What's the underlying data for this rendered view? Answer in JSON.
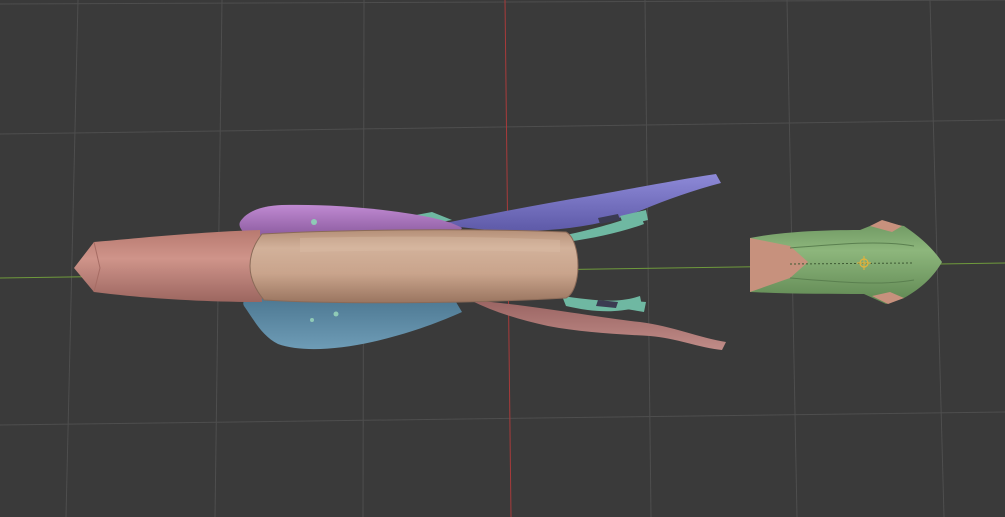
{
  "app": {
    "view": "3d-viewport",
    "mode": "sculpt-preview",
    "shading": "solid-random-color"
  },
  "viewport": {
    "background_color": "#3a3a3a",
    "grid_color": "#505050",
    "x_axis_color": "#6f9a3c",
    "y_axis_color": "#a83a3a"
  },
  "objects": [
    {
      "name": "main-body",
      "color": "#c9a48c"
    },
    {
      "name": "nose-cone",
      "color": "#c98a80"
    },
    {
      "name": "upper-left-wing",
      "color": "#b076c4"
    },
    {
      "name": "upper-right-fin",
      "color": "#7c78c8"
    },
    {
      "name": "lower-left-wing",
      "color": "#5e8aa4"
    },
    {
      "name": "lower-right-fin",
      "color": "#b07a78"
    },
    {
      "name": "teal-struts",
      "color": "#6fb8a2"
    },
    {
      "name": "detached-green-part",
      "color": "#7ea86e"
    },
    {
      "name": "green-part-rear-cap",
      "color": "#c7917d"
    }
  ],
  "origin_marker": {
    "color": "#e5b23a"
  }
}
